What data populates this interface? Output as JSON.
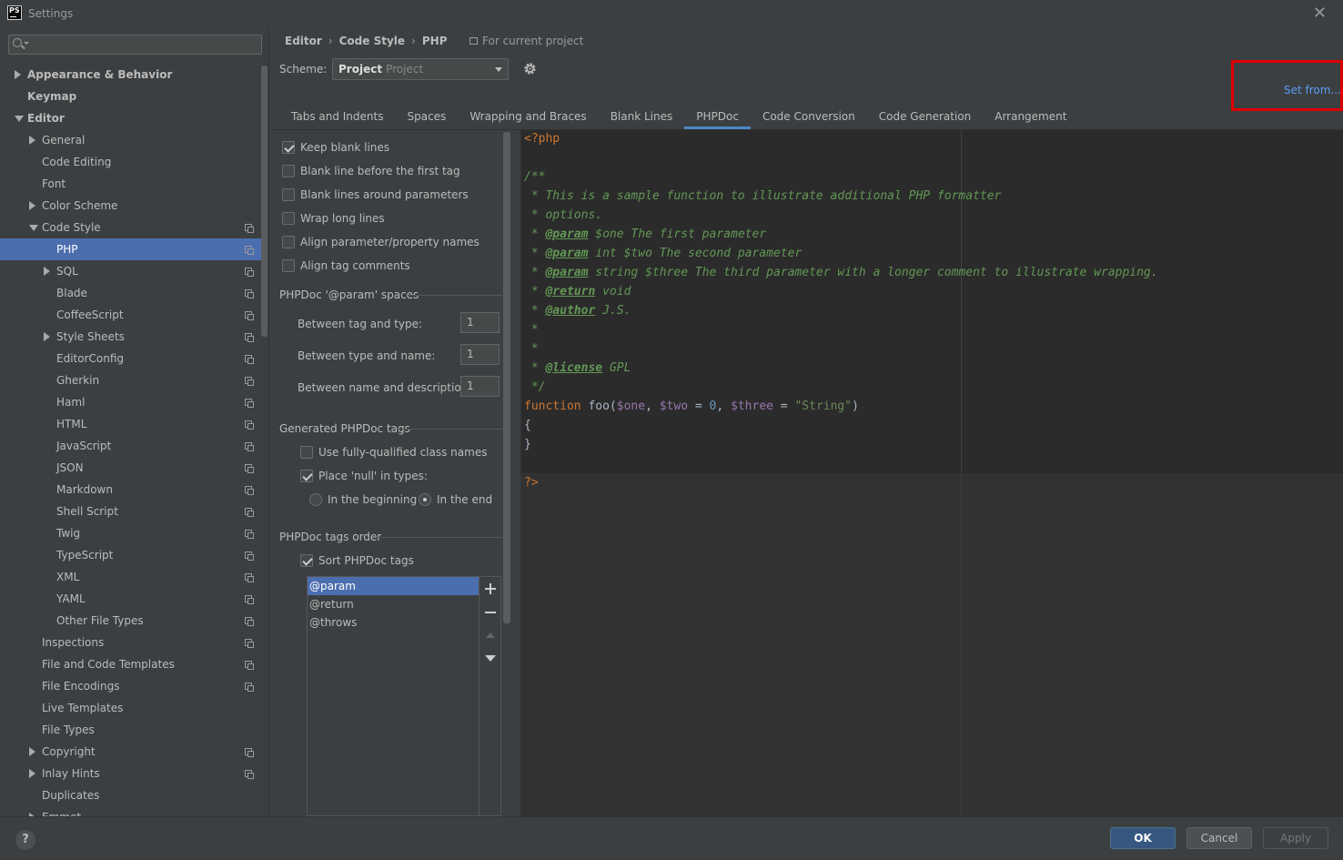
{
  "window": {
    "title": "Settings",
    "logo_text": "PS"
  },
  "search": {
    "placeholder": "",
    "value": ""
  },
  "sidebar": {
    "items": [
      {
        "label": "Appearance & Behavior",
        "indent": 0,
        "arrow": "right",
        "bold": true,
        "copy": false
      },
      {
        "label": "Keymap",
        "indent": 0,
        "arrow": "",
        "bold": true,
        "copy": false
      },
      {
        "label": "Editor",
        "indent": 0,
        "arrow": "down",
        "bold": true,
        "copy": false
      },
      {
        "label": "General",
        "indent": 1,
        "arrow": "right",
        "bold": false,
        "copy": false
      },
      {
        "label": "Code Editing",
        "indent": 1,
        "arrow": "",
        "bold": false,
        "copy": false
      },
      {
        "label": "Font",
        "indent": 1,
        "arrow": "",
        "bold": false,
        "copy": false
      },
      {
        "label": "Color Scheme",
        "indent": 1,
        "arrow": "right",
        "bold": false,
        "copy": false
      },
      {
        "label": "Code Style",
        "indent": 1,
        "arrow": "down",
        "bold": false,
        "copy": true
      },
      {
        "label": "PHP",
        "indent": 2,
        "arrow": "",
        "bold": false,
        "copy": true,
        "selected": true
      },
      {
        "label": "SQL",
        "indent": 2,
        "arrow": "right",
        "bold": false,
        "copy": true
      },
      {
        "label": "Blade",
        "indent": 2,
        "arrow": "",
        "bold": false,
        "copy": true
      },
      {
        "label": "CoffeeScript",
        "indent": 2,
        "arrow": "",
        "bold": false,
        "copy": true
      },
      {
        "label": "Style Sheets",
        "indent": 2,
        "arrow": "right",
        "bold": false,
        "copy": true
      },
      {
        "label": "EditorConfig",
        "indent": 2,
        "arrow": "",
        "bold": false,
        "copy": true
      },
      {
        "label": "Gherkin",
        "indent": 2,
        "arrow": "",
        "bold": false,
        "copy": true
      },
      {
        "label": "Haml",
        "indent": 2,
        "arrow": "",
        "bold": false,
        "copy": true
      },
      {
        "label": "HTML",
        "indent": 2,
        "arrow": "",
        "bold": false,
        "copy": true
      },
      {
        "label": "JavaScript",
        "indent": 2,
        "arrow": "",
        "bold": false,
        "copy": true
      },
      {
        "label": "JSON",
        "indent": 2,
        "arrow": "",
        "bold": false,
        "copy": true
      },
      {
        "label": "Markdown",
        "indent": 2,
        "arrow": "",
        "bold": false,
        "copy": true
      },
      {
        "label": "Shell Script",
        "indent": 2,
        "arrow": "",
        "bold": false,
        "copy": true
      },
      {
        "label": "Twig",
        "indent": 2,
        "arrow": "",
        "bold": false,
        "copy": true
      },
      {
        "label": "TypeScript",
        "indent": 2,
        "arrow": "",
        "bold": false,
        "copy": true
      },
      {
        "label": "XML",
        "indent": 2,
        "arrow": "",
        "bold": false,
        "copy": true
      },
      {
        "label": "YAML",
        "indent": 2,
        "arrow": "",
        "bold": false,
        "copy": true
      },
      {
        "label": "Other File Types",
        "indent": 2,
        "arrow": "",
        "bold": false,
        "copy": true
      },
      {
        "label": "Inspections",
        "indent": 1,
        "arrow": "",
        "bold": false,
        "copy": true
      },
      {
        "label": "File and Code Templates",
        "indent": 1,
        "arrow": "",
        "bold": false,
        "copy": true
      },
      {
        "label": "File Encodings",
        "indent": 1,
        "arrow": "",
        "bold": false,
        "copy": true
      },
      {
        "label": "Live Templates",
        "indent": 1,
        "arrow": "",
        "bold": false,
        "copy": false
      },
      {
        "label": "File Types",
        "indent": 1,
        "arrow": "",
        "bold": false,
        "copy": false
      },
      {
        "label": "Copyright",
        "indent": 1,
        "arrow": "right",
        "bold": false,
        "copy": true
      },
      {
        "label": "Inlay Hints",
        "indent": 1,
        "arrow": "right",
        "bold": false,
        "copy": true
      },
      {
        "label": "Duplicates",
        "indent": 1,
        "arrow": "",
        "bold": false,
        "copy": false
      },
      {
        "label": "Emmet",
        "indent": 1,
        "arrow": "right",
        "bold": false,
        "copy": false
      }
    ]
  },
  "header": {
    "breadcrumb": [
      "Editor",
      "Code Style",
      "PHP"
    ],
    "for_project": "For current project",
    "scheme_label": "Scheme:",
    "scheme_name": "Project",
    "scheme_sub": "Project",
    "set_from": "Set from..."
  },
  "tabs": [
    "Tabs and Indents",
    "Spaces",
    "Wrapping and Braces",
    "Blank Lines",
    "PHPDoc",
    "Code Conversion",
    "Code Generation",
    "Arrangement"
  ],
  "active_tab": 4,
  "options": {
    "checks": [
      {
        "label": "Keep blank lines",
        "checked": true
      },
      {
        "label": "Blank line before the first tag",
        "checked": false
      },
      {
        "label": "Blank lines around parameters",
        "checked": false
      },
      {
        "label": "Wrap long lines",
        "checked": false
      },
      {
        "label": "Align parameter/property names",
        "checked": false
      },
      {
        "label": "Align tag comments",
        "checked": false
      }
    ],
    "spaces_group": "PHPDoc '@param' spaces",
    "fields": [
      {
        "label": "Between tag and type:",
        "value": "1"
      },
      {
        "label": "Between type and name:",
        "value": "1"
      },
      {
        "label": "Between name and description:",
        "value": "1"
      }
    ],
    "generated_group": "Generated PHPDoc tags",
    "fq_names": {
      "label": "Use fully-qualified class names",
      "checked": false
    },
    "place_null": {
      "label": "Place 'null' in types:",
      "checked": true
    },
    "radio_begin": {
      "label": "In the beginning",
      "checked": false
    },
    "radio_end": {
      "label": "In the end",
      "checked": true
    },
    "order_group": "PHPDoc tags order",
    "sort_tags": {
      "label": "Sort PHPDoc tags",
      "checked": true
    },
    "tags": [
      "@param",
      "@return",
      "@throws"
    ],
    "selected_tag": 0
  },
  "code": {
    "open_tag": "<?php",
    "close_tag": "?>",
    "doc_open": "/**",
    "doc_line1": " * This is a sample function to illustrate additional PHP formatter",
    "doc_line2": " * options.",
    "param1_tag": "@param",
    "param1_rest": " $one The first parameter",
    "param2_tag": "@param",
    "param2_rest": " int $two The second parameter",
    "param3_tag": "@param",
    "param3_rest": " string $three The third parameter with a longer comment to illustrate wrapping.",
    "return_tag": "@return",
    "return_rest": " void",
    "author_tag": "@author",
    "author_rest": " J.S.",
    "license_tag": "@license",
    "license_rest": " GPL",
    "doc_star": " *",
    "doc_close": " */",
    "fn_kw": "function",
    "fn_name": " foo(",
    "var_one": "$one",
    "comma1": ", ",
    "var_two": "$two",
    "eq1": " = ",
    "num0": "0",
    "comma2": ", ",
    "var_three": "$three",
    "eq2": " = ",
    "str": "\"String\"",
    "close_paren": ")",
    "brace_open": "{",
    "brace_close": "}"
  },
  "buttons": {
    "help": "?",
    "ok": "OK",
    "cancel": "Cancel",
    "apply": "Apply"
  },
  "colors": {
    "accent": "#4b6eaf",
    "link": "#589df6",
    "highlight_border": "#e00000"
  }
}
